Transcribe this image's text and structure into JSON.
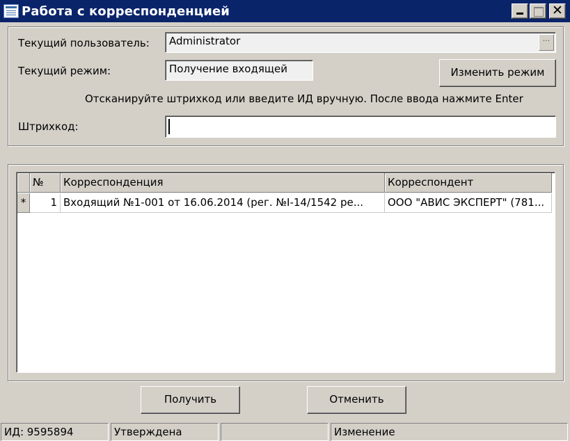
{
  "window": {
    "title": "Работа с корреспонденцией",
    "icon": "window-list-icon",
    "controls": [
      "minimize",
      "maximize",
      "close"
    ],
    "close_glyph": "✕"
  },
  "form": {
    "user_label": "Текущий пользователь:",
    "user_value": "Administrator",
    "user_browse": "···",
    "mode_label": "Текущий режим:",
    "mode_value": "Получение входящей",
    "change_mode_button": "Изменить режим",
    "instruction": "Отсканируйте штрихкод или введите ИД вручную. После ввода нажмите Enter",
    "barcode_label": "Штрихкод:",
    "barcode_value": ""
  },
  "table": {
    "columns": [
      "№",
      "Корреспонденция",
      "Корреспондент"
    ],
    "rows": [
      {
        "marker": "*",
        "number": "1",
        "correspondence": "Входящий №1-001 от 16.06.2014 (рег. №I-14/1542 ре...",
        "correspondent": "ООО \"АВИС ЭКСПЕРТ\" (781..."
      }
    ]
  },
  "actions": {
    "receive_button": "Получить",
    "cancel_button": "Отменить"
  },
  "statusbar": {
    "id": "ИД: 9595894",
    "state": "Утверждена",
    "empty": "",
    "change": "Изменение"
  }
}
